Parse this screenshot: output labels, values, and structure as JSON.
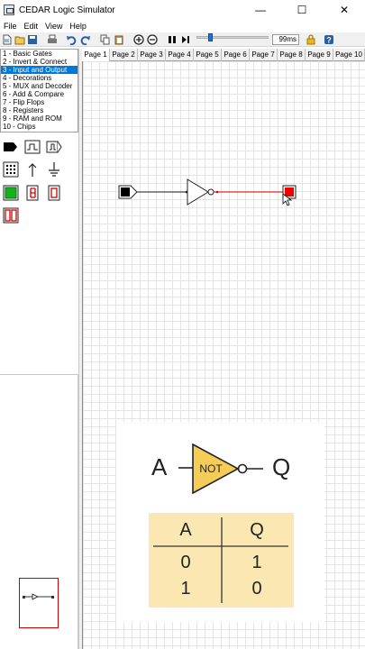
{
  "window": {
    "title": "CEDAR Logic Simulator",
    "controls": [
      "—",
      "☐",
      "✕"
    ]
  },
  "menu": [
    "File",
    "Edit",
    "View",
    "Help"
  ],
  "toolbar": {
    "speed": "99ms"
  },
  "libraries": [
    {
      "label": "1  - Basic Gates"
    },
    {
      "label": "2  - Invert & Connect"
    },
    {
      "label": "3  - Input and Output"
    },
    {
      "label": "4  - Decorations"
    },
    {
      "label": "5  - MUX and Decoder"
    },
    {
      "label": "6  - Add & Compare"
    },
    {
      "label": "7  - Flip Flops"
    },
    {
      "label": "8  - Registers"
    },
    {
      "label": "9  - RAM and ROM"
    },
    {
      "label": "10 - Chips"
    }
  ],
  "selected_library_index": 2,
  "tabs": [
    "Page 1",
    "Page 2",
    "Page 3",
    "Page 4",
    "Page 5",
    "Page 6",
    "Page 7",
    "Page 8",
    "Page 9",
    "Page 10"
  ],
  "active_tab_index": 0,
  "overlay": {
    "input_label": "A",
    "gate_label": "NOT",
    "output_label": "Q",
    "table": {
      "headers": [
        "A",
        "Q"
      ],
      "rows": [
        [
          "0",
          "1"
        ],
        [
          "1",
          "0"
        ]
      ]
    }
  },
  "colors": {
    "selection": "#0078d7",
    "wire_active": "#e00000",
    "led_on": "#ee0000",
    "gate_fill": "#f5cc55",
    "table_fill": "#fbe7b1"
  }
}
